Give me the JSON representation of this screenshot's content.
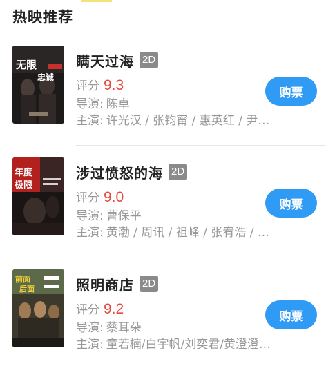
{
  "section_title": "热映推荐",
  "colors": {
    "accent_blue": "#2f9bf4",
    "score_red": "#e8463f",
    "badge_gray": "#8a8a8a",
    "muted_text": "#999999"
  },
  "movies": [
    {
      "title": "瞒天过海",
      "format": "2D",
      "score_label": "评分",
      "score": "9.3",
      "director_label": "导演:",
      "director": "陈卓",
      "cast_label": "主演:",
      "cast": "许光汉 / 张钧甯 / 惠英红 / 尹…",
      "buy_label": "购票",
      "poster_text": [
        "无限",
        "忠诚"
      ]
    },
    {
      "title": "涉过愤怒的海",
      "format": "2D",
      "score_label": "评分",
      "score": "9.0",
      "director_label": "导演:",
      "director": "曹保平",
      "cast_label": "主演:",
      "cast": "黄渤 / 周讯 / 祖峰 / 张宥浩 / …",
      "buy_label": "购票",
      "poster_text": [
        "年度",
        "极限"
      ]
    },
    {
      "title": "照明商店",
      "format": "2D",
      "score_label": "评分",
      "score": "9.2",
      "director_label": "导演:",
      "director": "蔡耳朵",
      "cast_label": "主演:",
      "cast": "童若楠/白宇帆/刘奕君/黄澄澄…",
      "buy_label": "购票",
      "poster_text": [
        "前面",
        "后面"
      ]
    }
  ]
}
